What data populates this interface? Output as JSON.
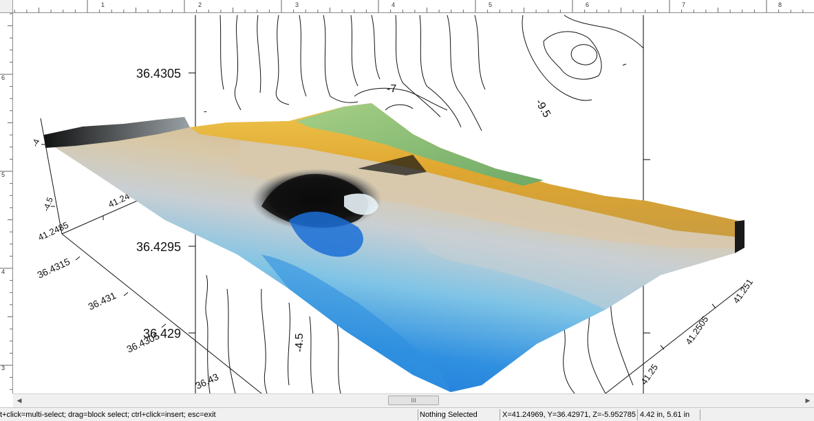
{
  "ruler": {
    "h_labels": [
      "1",
      "2",
      "3",
      "4",
      "5",
      "6",
      "7",
      "8"
    ],
    "v_labels": [
      "6",
      "5",
      "4",
      "3"
    ]
  },
  "contour_map": {
    "y_ticks": [
      "36.4305",
      "36.4295",
      "36.429"
    ],
    "contour_labels": [
      "-7",
      "-9.5",
      "-4.5"
    ]
  },
  "surface_3d": {
    "z_axis_label": "-4",
    "x_axis_left_ticks": [
      "41.249",
      "41.2485"
    ],
    "y_axis_ticks": [
      "36.4315",
      "36.431",
      "36.4305",
      "36.43"
    ],
    "x_axis_right_ticks": [
      "41.251",
      "41.2505",
      "41.25"
    ],
    "colors": {
      "deep_blue": "#1a6fd6",
      "light_blue": "#7fc4e6",
      "gray": "#c9cfd3",
      "tan": "#cdb58a",
      "gold": "#e0a52a",
      "green": "#8fc27a",
      "black": "#111111"
    }
  },
  "scrollbar": {
    "grip": "III"
  },
  "status": {
    "hint": "t+click=multi-select; drag=block select; ctrl+click=insert; esc=exit",
    "selection": "Nothing Selected",
    "coordinates": "X=41.24969, Y=36.42971, Z=-5.952785",
    "size": "4.42 in, 5.61 in"
  }
}
